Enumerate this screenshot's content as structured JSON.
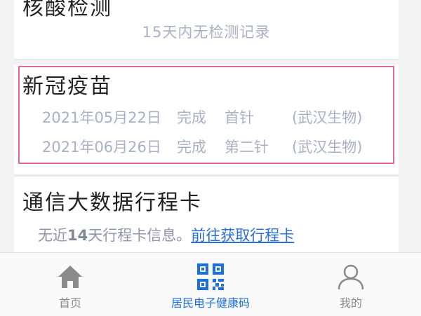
{
  "top_card": {
    "title": "核酸检测",
    "note": "15天内无检测记录"
  },
  "vaccine": {
    "title": "新冠疫苗",
    "records": [
      {
        "date": "2021年05月22日",
        "status": "完成",
        "dose": "首针",
        "maker": "(武汉生物)"
      },
      {
        "date": "2021年06月26日",
        "status": "完成",
        "dose": "第二针",
        "maker": "(武汉生物)"
      }
    ],
    "highlight_color": "#e06a94"
  },
  "travel": {
    "title": "通信大数据行程卡",
    "note_prefix": "无近",
    "note_days": "14",
    "note_suffix": "天行程卡信息。",
    "link_label": "前往获取行程卡"
  },
  "tabbar": {
    "tabs": [
      {
        "label": "首页",
        "icon": "home-icon",
        "active": false
      },
      {
        "label": "居民电子健康码",
        "icon": "qr-code-icon",
        "active": true
      },
      {
        "label": "我的",
        "icon": "user-icon",
        "active": false
      }
    ],
    "active_color": "#1c6fe0"
  }
}
